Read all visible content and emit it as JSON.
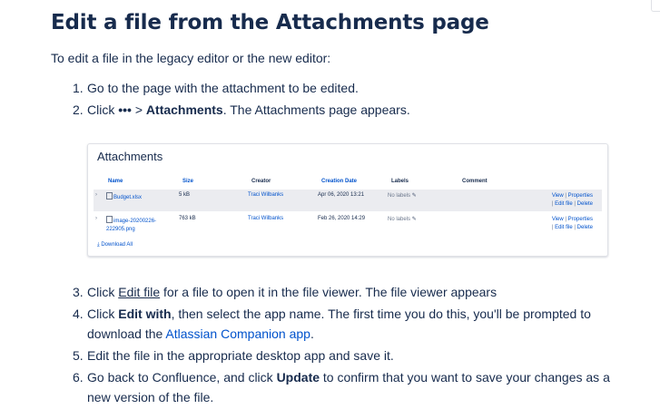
{
  "title": "Edit a file from the Attachments page",
  "intro": "To edit a file in the legacy editor or the new editor:",
  "steps_a": [
    {
      "num": "1.",
      "text": "Go to the page with the attachment to be edited."
    },
    {
      "num": "2.",
      "pre": "Click ",
      "ellipsis": "•••",
      "gt": " > ",
      "bold": "Attachments",
      "post": ". The Attachments page appears."
    }
  ],
  "attachments": {
    "title": "Attachments",
    "columns": {
      "name": "Name",
      "size": "Size",
      "creator": "Creator",
      "created": "Creation Date",
      "labels": "Labels",
      "comment": "Comment"
    },
    "rows": [
      {
        "chevron": "›",
        "file": "Budget.xlsx",
        "file2": "",
        "size": "5 kB",
        "creator": "Traci Wilbanks",
        "date": "Apr 06, 2020 13:21",
        "labels": "No labels",
        "view": "View",
        "properties": "Properties",
        "edit": "Edit file",
        "delete": "Delete"
      },
      {
        "chevron": "›",
        "file": "image-20200226-",
        "file2": "222905.png",
        "size": "763 kB",
        "creator": "Traci Wilbanks",
        "date": "Feb 26, 2020 14:29",
        "labels": "No labels",
        "view": "View",
        "properties": "Properties",
        "edit": "Edit file",
        "delete": "Delete"
      }
    ],
    "download_all": "Download All",
    "pencil_icon": "pencil-icon",
    "download_icon": "download-icon",
    "file_icon": "file-icon"
  },
  "steps_b": [
    {
      "num": "3.",
      "pre": "Click ",
      "link": "Edit file",
      "post": " for a file to open it in the file viewer. The file viewer appears"
    },
    {
      "num": "4.",
      "pre": "Click ",
      "bold": "Edit with",
      "mid": ", then select the app name. The first time you do this, you'll be prompted to",
      "cont_pre": "download the ",
      "link": "Atlassian Companion app",
      "cont_post": "."
    },
    {
      "num": "5.",
      "text": "Edit the file in the appropriate desktop app and save it."
    },
    {
      "num": "6.",
      "pre": "Go back to Confluence, and click ",
      "bold": "Update",
      "mid": " to confirm that you want to save your changes as a",
      "cont": "new version of the file."
    }
  ],
  "colors": {
    "text": "#172b4d",
    "link": "#0052cc",
    "row_highlight": "#ebecf0"
  }
}
